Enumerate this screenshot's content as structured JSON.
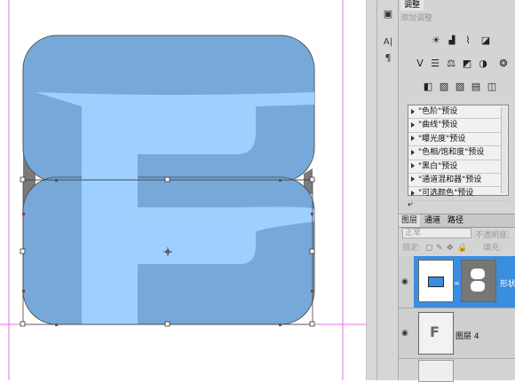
{
  "right_toolstrip": {
    "icons": [
      "clipboard-icon",
      "character-icon",
      "paragraph-icon"
    ],
    "char_label": "A|",
    "para_label": "¶"
  },
  "adjustments_panel": {
    "tab_label": "调整",
    "tab_label_2": "",
    "subtitle": "添加调整",
    "row1_icons": [
      "brightness-icon",
      "levels-icon",
      "curves-icon",
      "exposure-icon"
    ],
    "row2_icons": [
      "vibrance-icon",
      "hue-saturation-icon",
      "color-balance-icon",
      "black-white-icon",
      "photo-filter-icon",
      "channel-mixer-icon"
    ],
    "row3_icons": [
      "invert-icon",
      "posterize-icon",
      "threshold-icon",
      "gradient-map-icon",
      "selective-color-icon"
    ],
    "presets": [
      "\"色阶\"预设",
      "\"曲线\"预设",
      "\"曝光度\"预设",
      "\"色相/饱和度\"预设",
      "\"黑白\"预设",
      "\"通道混和器\"预设",
      "\"可选颜色\"预设"
    ]
  },
  "layers_panel": {
    "tabs": [
      "图层",
      "通道",
      "路径"
    ],
    "blend_mode": "正常",
    "opacity_label": "不透明度:",
    "lock_label": "锁定:",
    "fill_label": "填充:",
    "layers": [
      {
        "name": "形状",
        "selected": true
      },
      {
        "name": "图层 4",
        "selected": false
      }
    ]
  },
  "colors": {
    "shape_fill": "#76a9d9",
    "letter_fill": "#9ed0ff",
    "guide": "#e56fe0",
    "selection_blue": "#3a8ee0"
  }
}
